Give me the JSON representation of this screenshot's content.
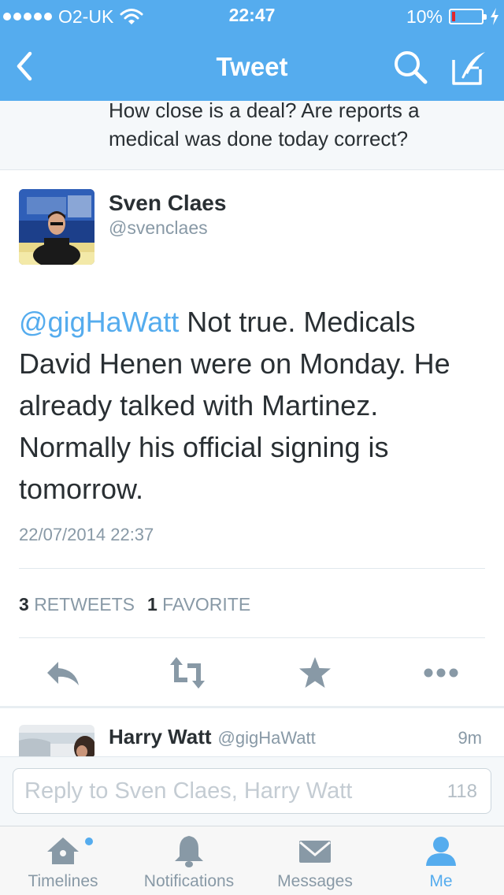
{
  "status_bar": {
    "carrier": "O2-UK",
    "time": "22:47",
    "battery": "10%",
    "battery_level": 0.1,
    "battery_color": "#e0262e"
  },
  "nav": {
    "title": "Tweet",
    "back_icon": "chevron-left-icon",
    "search_icon": "search-icon",
    "compose_icon": "compose-icon"
  },
  "previous_tweet": {
    "text": "How close is a deal? Are reports a medical was done today correct?"
  },
  "tweet": {
    "author_name": "Sven Claes",
    "author_handle": "@svenclaes",
    "mention": "@gigHaWatt",
    "text": "Not true. Medicals David Henen were on Monday. He already talked with Martinez. Normally his official signing is tomorrow.",
    "timestamp": "22/07/2014 22:37",
    "retweets_count": "3",
    "retweets_label": "RETWEETS",
    "favorites_count": "1",
    "favorites_label": "FAVORITE"
  },
  "actions": [
    "reply-icon",
    "retweet-icon",
    "favorite-star-icon",
    "more-icon"
  ],
  "reply_tweet": {
    "author_name": "Harry Watt",
    "author_handle": "@gigHaWatt",
    "time": "9m"
  },
  "composer": {
    "placeholder": "Reply to Sven Claes, Harry Watt",
    "char_count": "118"
  },
  "tabs": [
    {
      "label": "Timelines",
      "icon": "home-icon",
      "active": false,
      "unread": true
    },
    {
      "label": "Notifications",
      "icon": "bell-icon",
      "active": false
    },
    {
      "label": "Messages",
      "icon": "envelope-icon",
      "active": false
    },
    {
      "label": "Me",
      "icon": "person-icon",
      "active": true
    }
  ],
  "colors": {
    "brand_blue": "#55acee",
    "text_dark": "#292f33",
    "text_gray": "#8899a6"
  }
}
